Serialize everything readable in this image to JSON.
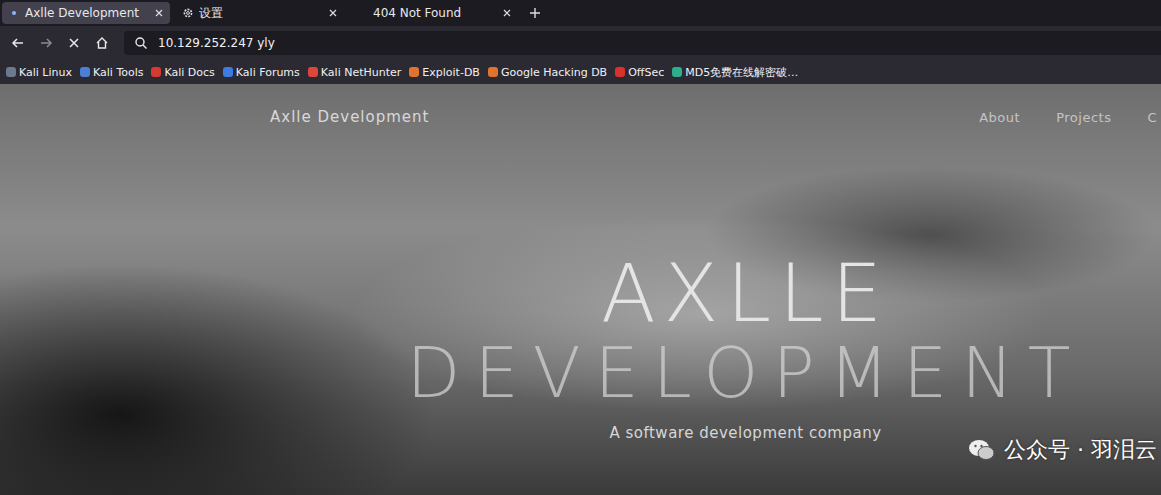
{
  "browser": {
    "tabs": [
      {
        "label": "Axlle Development",
        "selected": true,
        "loading": true,
        "kind": "page"
      },
      {
        "label": "设置",
        "selected": false,
        "loading": false,
        "kind": "settings"
      },
      {
        "label": "404 Not Found",
        "selected": false,
        "loading": false,
        "kind": "page"
      }
    ]
  },
  "toolbar": {
    "url": "10.129.252.247 yly",
    "loading": true
  },
  "bookmarks": [
    {
      "label": "Kali Linux",
      "color": "#6b7a8f"
    },
    {
      "label": "Kali Tools",
      "color": "#4a7fd6"
    },
    {
      "label": "Kali Docs",
      "color": "#d33b2f"
    },
    {
      "label": "Kali Forums",
      "color": "#3d7be0"
    },
    {
      "label": "Kali NetHunter",
      "color": "#e0463b"
    },
    {
      "label": "Exploit-DB",
      "color": "#e0742e"
    },
    {
      "label": "Google Hacking DB",
      "color": "#e0742e"
    },
    {
      "label": "OffSec",
      "color": "#d8322a"
    },
    {
      "label": "MD5免费在线解密破…",
      "color": "#2fae8f"
    }
  ],
  "page": {
    "brand": "Axlle Development",
    "nav": [
      "About",
      "Projects",
      "C"
    ],
    "title": "AXLLE",
    "subtitle": "DEVELOPMENT",
    "tagline": "A software development company"
  },
  "watermark": "公众号 · 羽泪云"
}
